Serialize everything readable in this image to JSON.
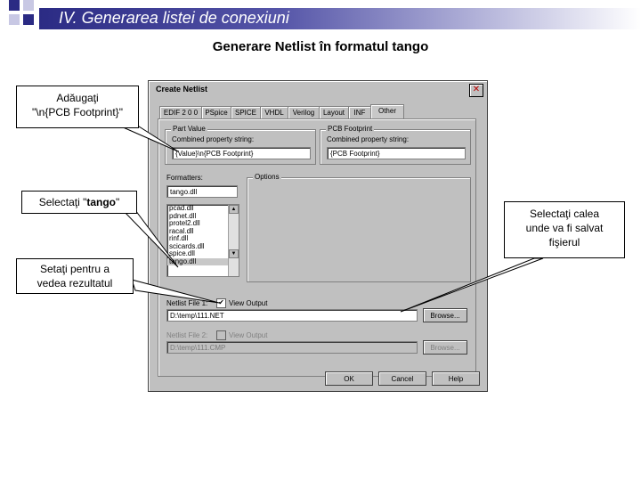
{
  "slide": {
    "title": "IV. Generarea listei de conexiuni",
    "subtitle": "Generare Netlist în formatul tango",
    "colors": {
      "header_dark": "#2b2b84",
      "square_blue": "#2b2b84",
      "square_light": "#c8c8e4"
    }
  },
  "callouts": {
    "footprint_line1": "Adăugaţi",
    "footprint_line2": "\"\\n{PCB Footprint}\"",
    "tango_prefix": "Selectaţi \"",
    "tango_bold": "tango",
    "tango_suffix": "\"",
    "view_line1": "Setaţi pentru a",
    "view_line2": "vedea rezultatul",
    "path_line1": "Selectaţi calea",
    "path_line2": "unde va fi salvat",
    "path_line3": "fişierul"
  },
  "dialog": {
    "title": "Create Netlist",
    "close_glyph": "✕",
    "tabs": [
      "EDIF 2 0 0",
      "PSpice",
      "SPICE",
      "VHDL",
      "Verilog",
      "Layout",
      "INF",
      "Other"
    ],
    "part_value": {
      "group_label": "Part Value",
      "label": "Combined property string:",
      "value": "{Value}\\n{PCB Footprint}"
    },
    "pcb_footprint": {
      "group_label": "PCB Footprint",
      "label": "Combined property string:",
      "value": "{PCB Footprint}"
    },
    "formatters": {
      "label": "Formatters:",
      "value": "tango.dll",
      "items": [
        "pcad.dll",
        "pdnet.dll",
        "protel2.dll",
        "racal.dll",
        "rinf.dll",
        "scicards.dll",
        "spice.dll",
        "tango.dll"
      ],
      "selected": "tango.dll"
    },
    "options": {
      "label": "Options"
    },
    "netlist1": {
      "label": "Netlist File 1:",
      "view_output_label": "View Output",
      "view_output_checked": "✔",
      "value": "D:\\temp\\111.NET",
      "browse": "Browse..."
    },
    "netlist2": {
      "label": "Netlist File 2:",
      "view_output_label": "View Output",
      "value": "D:\\temp\\111.CMP",
      "browse": "Browse..."
    },
    "buttons": {
      "ok": "OK",
      "cancel": "Cancel",
      "help": "Help"
    }
  }
}
